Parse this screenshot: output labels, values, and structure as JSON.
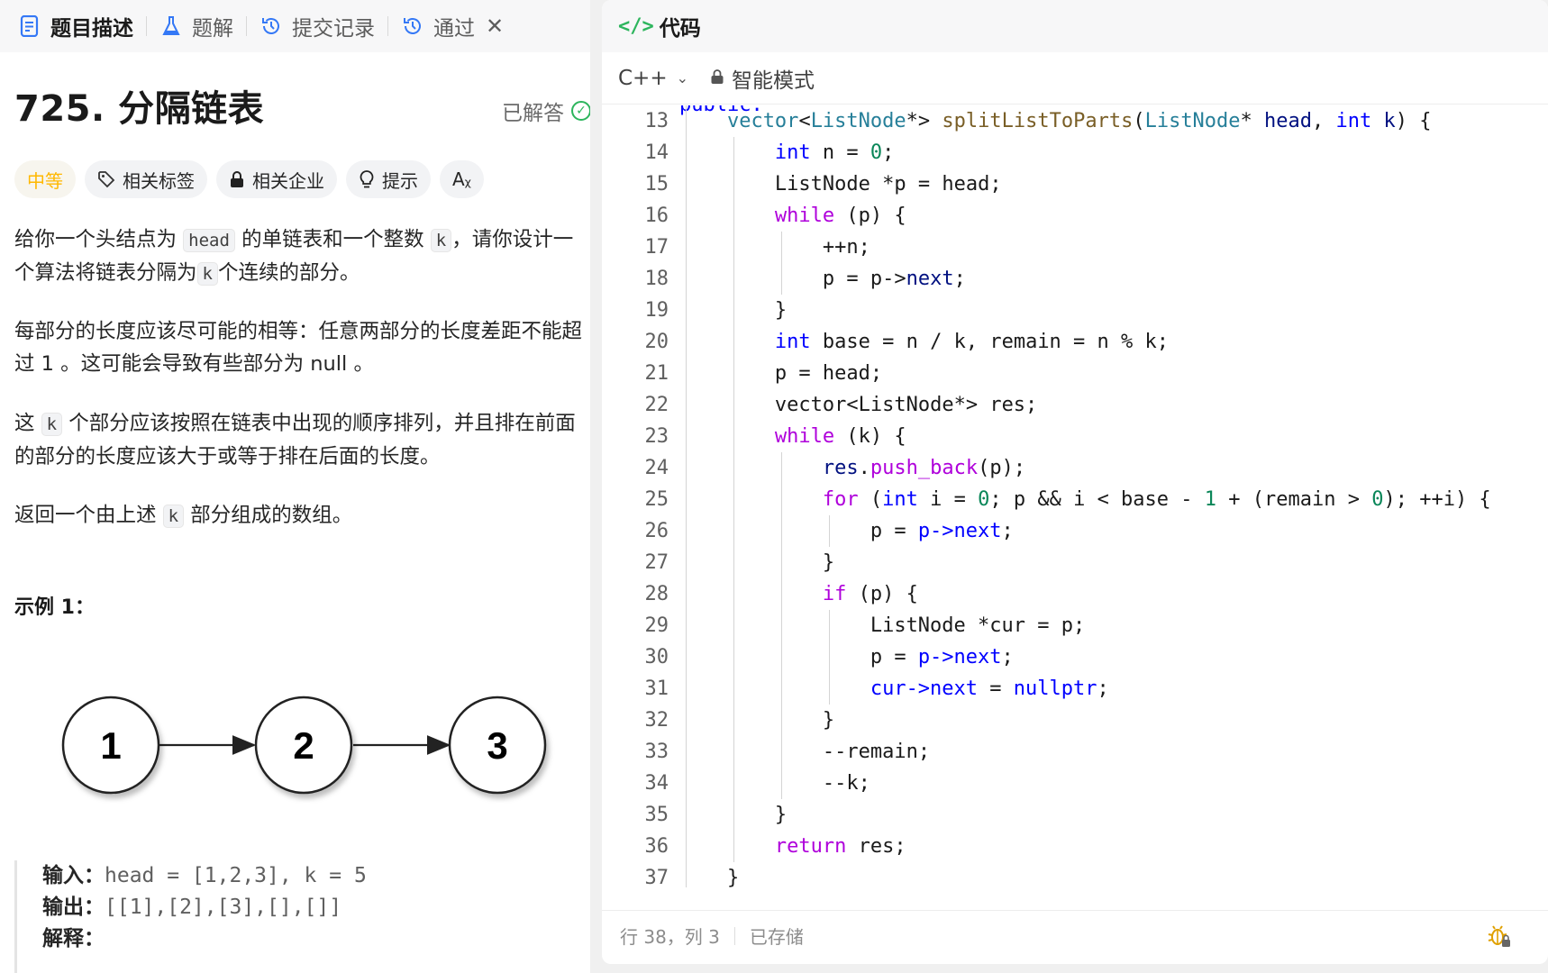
{
  "left_tabs": [
    {
      "label": "题目描述",
      "icon": "document-icon",
      "active": true
    },
    {
      "label": "题解",
      "icon": "flask-icon",
      "active": false
    },
    {
      "label": "提交记录",
      "icon": "history-icon",
      "active": false
    },
    {
      "label": "通过",
      "icon": "history-icon",
      "active": false
    }
  ],
  "close_glyph": "✕",
  "problem": {
    "title": "725. 分隔链表",
    "status": "已解答",
    "difficulty": "中等",
    "tags": [
      "相关标签",
      "相关企业",
      "提示"
    ],
    "font_glyph": "Aᵪ",
    "para1": [
      "给你一个头结点为",
      "head",
      "的单链表和一个整数",
      "k",
      "，请你设计一个算法将链表分隔为",
      "k",
      "个连续的部分。"
    ],
    "para2": "每部分的长度应该尽可能的相等：任意两部分的长度差距不能超过 1 。这可能会导致有些部分为 null 。",
    "para3": [
      "这",
      "k",
      "个部分应该按照在链表中出现的顺序排列，并且排在前面的部分的长度应该大于或等于排在后面的长度。"
    ],
    "para4": [
      "返回一个由上述",
      "k",
      "部分组成的数组。"
    ],
    "example_title": "示例 1：",
    "nodes": [
      "1",
      "2",
      "3"
    ],
    "example": {
      "input_label": "输入：",
      "input": "head = [1,2,3], k = 5",
      "output_label": "输出：",
      "output": "[[1],[2],[3],[],[]]",
      "explain_label": "解释："
    }
  },
  "editor": {
    "header": "代码",
    "header_icon": "</>",
    "language": "C++",
    "mode": "智能模式",
    "status_position": "行 38，列 3",
    "status_saved": "已存储",
    "top_partial": "public:",
    "lines": [
      {
        "n": "13",
        "indent": 1,
        "tokens": [
          [
            "vector",
            "t"
          ],
          [
            "<",
            ""
          ],
          [
            "ListNode",
            "t"
          ],
          [
            "*> ",
            ""
          ],
          [
            "splitListToParts",
            "f"
          ],
          [
            "(",
            ""
          ],
          [
            "ListNode",
            "t"
          ],
          [
            "* ",
            ""
          ],
          [
            "head",
            "v"
          ],
          [
            ", ",
            ""
          ],
          [
            "int",
            "k"
          ],
          [
            " ",
            ""
          ],
          [
            "k",
            "v"
          ],
          [
            ") {",
            ""
          ]
        ]
      },
      {
        "n": "14",
        "indent": 2,
        "tokens": [
          [
            "int",
            "k"
          ],
          [
            " n = ",
            ""
          ],
          [
            "0",
            "n"
          ],
          [
            ";",
            ""
          ]
        ]
      },
      {
        "n": "15",
        "indent": 2,
        "tokens": [
          [
            "ListNode *p = head;",
            ""
          ]
        ]
      },
      {
        "n": "16",
        "indent": 2,
        "tokens": [
          [
            "while",
            "c"
          ],
          [
            " (p) {",
            ""
          ]
        ]
      },
      {
        "n": "17",
        "indent": 3,
        "tokens": [
          [
            "++n;",
            ""
          ]
        ]
      },
      {
        "n": "18",
        "indent": 3,
        "tokens": [
          [
            "p = ",
            ""
          ],
          [
            "p",
            ""
          ],
          [
            "->",
            ""
          ],
          [
            "next",
            "v"
          ],
          [
            ";",
            ""
          ]
        ]
      },
      {
        "n": "19",
        "indent": 2,
        "tokens": [
          [
            "}",
            ""
          ]
        ]
      },
      {
        "n": "20",
        "indent": 2,
        "tokens": [
          [
            "int",
            "k"
          ],
          [
            " base = n / k, remain = n % k;",
            ""
          ]
        ]
      },
      {
        "n": "21",
        "indent": 2,
        "tokens": [
          [
            "p = head;",
            ""
          ]
        ]
      },
      {
        "n": "22",
        "indent": 2,
        "tokens": [
          [
            "vector<ListNode*> res;",
            ""
          ]
        ]
      },
      {
        "n": "23",
        "indent": 2,
        "tokens": [
          [
            "while",
            "c"
          ],
          [
            " (k) {",
            ""
          ]
        ]
      },
      {
        "n": "24",
        "indent": 3,
        "tokens": [
          [
            "res",
            "v"
          ],
          [
            ".",
            ""
          ],
          [
            "push_back",
            "c"
          ],
          [
            "(p);",
            ""
          ]
        ]
      },
      {
        "n": "25",
        "indent": 3,
        "tokens": [
          [
            "for",
            "c"
          ],
          [
            " (",
            ""
          ],
          [
            "int",
            "k"
          ],
          [
            " i = ",
            ""
          ],
          [
            "0",
            "n"
          ],
          [
            "; p && i < base - ",
            ""
          ],
          [
            "1",
            "n"
          ],
          [
            " + (remain > ",
            ""
          ],
          [
            "0",
            "n"
          ],
          [
            "); ++i) {",
            ""
          ]
        ]
      },
      {
        "n": "26",
        "indent": 4,
        "tokens": [
          [
            "p = ",
            ""
          ],
          [
            "p->next",
            "x"
          ],
          [
            ";",
            ""
          ]
        ]
      },
      {
        "n": "27",
        "indent": 3,
        "tokens": [
          [
            "}",
            ""
          ]
        ]
      },
      {
        "n": "28",
        "indent": 3,
        "tokens": [
          [
            "if",
            "c"
          ],
          [
            " (p) {",
            ""
          ]
        ]
      },
      {
        "n": "29",
        "indent": 4,
        "tokens": [
          [
            "ListNode *cur = p;",
            ""
          ]
        ]
      },
      {
        "n": "30",
        "indent": 4,
        "tokens": [
          [
            "p = ",
            ""
          ],
          [
            "p->next",
            "x"
          ],
          [
            ";",
            ""
          ]
        ]
      },
      {
        "n": "31",
        "indent": 4,
        "tokens": [
          [
            "cur->next",
            "x"
          ],
          [
            " = ",
            ""
          ],
          [
            "nullptr",
            "k"
          ],
          [
            ";",
            ""
          ]
        ]
      },
      {
        "n": "32",
        "indent": 3,
        "tokens": [
          [
            "}",
            ""
          ]
        ]
      },
      {
        "n": "33",
        "indent": 3,
        "tokens": [
          [
            "--remain;",
            ""
          ]
        ]
      },
      {
        "n": "34",
        "indent": 3,
        "tokens": [
          [
            "--k;",
            ""
          ]
        ]
      },
      {
        "n": "35",
        "indent": 2,
        "tokens": [
          [
            "}",
            ""
          ]
        ]
      },
      {
        "n": "36",
        "indent": 2,
        "tokens": [
          [
            "return",
            "c"
          ],
          [
            " res;",
            ""
          ]
        ]
      },
      {
        "n": "37",
        "indent": 1,
        "tokens": [
          [
            "}",
            ""
          ]
        ]
      }
    ]
  },
  "colors": {
    "accent_green": "#2db55d",
    "difficulty": "#ffb800",
    "keyword": "#0000ff",
    "control": "#af00db",
    "type": "#267f99",
    "function": "#795e26",
    "number": "#098658"
  }
}
